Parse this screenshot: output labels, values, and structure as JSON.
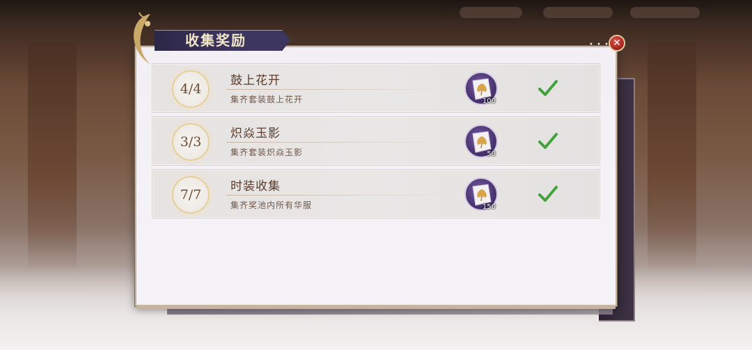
{
  "dialog": {
    "title": "收集奖励",
    "close_icon": "close-icon",
    "ornament_icon": "crescent-ornament-icon"
  },
  "rows": [
    {
      "progress": "4/4",
      "title": "鼓上花开",
      "description": "集齐套装鼓上花开",
      "reward": {
        "icon": "ginkgo-cloth-icon",
        "count": "100"
      },
      "status_icon": "checkmark-icon"
    },
    {
      "progress": "3/3",
      "title": "炽焱玉影",
      "description": "集齐套装炽焱玉影",
      "reward": {
        "icon": "ginkgo-cloth-icon",
        "count": "50"
      },
      "status_icon": "checkmark-icon"
    },
    {
      "progress": "7/7",
      "title": "时装收集",
      "description": "集齐奖池内所有华服",
      "reward": {
        "icon": "ginkgo-cloth-icon",
        "count": "150"
      },
      "status_icon": "checkmark-icon"
    }
  ],
  "colors": {
    "title_banner": "#3d3760",
    "check_green": "#3fa33a",
    "close_red": "#b8342b"
  }
}
